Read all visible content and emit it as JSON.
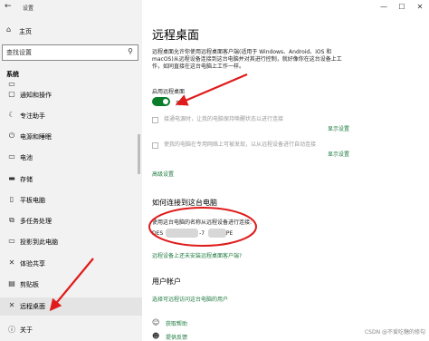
{
  "window": {
    "app_title": "设置",
    "controls": [
      "—",
      "☐",
      "✕"
    ]
  },
  "sidebar": {
    "home_label": "主页",
    "search_placeholder": "查找设置",
    "section_title": "系统",
    "items": [
      {
        "icon": "monitor-icon",
        "glyph": "▭",
        "label": ""
      },
      {
        "icon": "notification-icon",
        "glyph": "▢",
        "label": "通知和操作"
      },
      {
        "icon": "focus-assist-icon",
        "glyph": "☾",
        "label": "专注助手"
      },
      {
        "icon": "power-icon",
        "glyph": "⏻",
        "label": "电源和睡眠"
      },
      {
        "icon": "battery-icon",
        "glyph": "▭",
        "label": "电池"
      },
      {
        "icon": "storage-icon",
        "glyph": "▬",
        "label": "存储"
      },
      {
        "icon": "tablet-icon",
        "glyph": "▯",
        "label": "平板电脑"
      },
      {
        "icon": "multitasking-icon",
        "glyph": "⧉",
        "label": "多任务处理"
      },
      {
        "icon": "projecting-icon",
        "glyph": "▭",
        "label": "投影到此电脑"
      },
      {
        "icon": "shared-experiences-icon",
        "glyph": "✕",
        "label": "体验共享"
      },
      {
        "icon": "clipboard-icon",
        "glyph": "▤",
        "label": "剪贴板"
      },
      {
        "icon": "remote-desktop-icon",
        "glyph": "✕",
        "label": "远程桌面"
      },
      {
        "icon": "about-icon",
        "glyph": "ⓘ",
        "label": "关于"
      }
    ]
  },
  "main": {
    "title": "远程桌面",
    "description": "远程桌面允许你使用远程桌面客户端(适用于 Windows、Android、iOS 和 macOS)从远程设备连接到这台电脑并对其进行控制，就好像你在这台设备上工作，如同直接在这台电脑上工作一样。",
    "enable_label": "启用远程桌面",
    "toggle_state": "开",
    "checkbox1": "接通电源时，让我的电脑保持唤醒状态以进行连接",
    "checkbox2": "使我的电脑在专用网络上可被发现，以从远程设备进行自动连接",
    "show_settings_label": "显示设置",
    "advanced_settings": "高级设置",
    "connect_heading": "如何连接到这台电脑",
    "connect_instruction": "使用这台电脑的名称从远程设备进行连接:",
    "pc_name_prefix": "DES",
    "pc_name_mid": "-7",
    "pc_name_suffix": "PE",
    "no_client_link": "远程设备上还未安装远程桌面客户端?",
    "accounts_heading": "用户帐户",
    "select_users_link": "选择可远程访问这台电脑的用户",
    "get_help": "获取帮助",
    "feedback": "提供反馈"
  },
  "watermark": "CSDN @不爱吃糖的修勾",
  "colors": {
    "accent_green": "#0a7d2b",
    "link_green": "#1e7a3f",
    "annotation_red": "#e01b1b",
    "sidebar_bg": "#f2f2f2"
  }
}
